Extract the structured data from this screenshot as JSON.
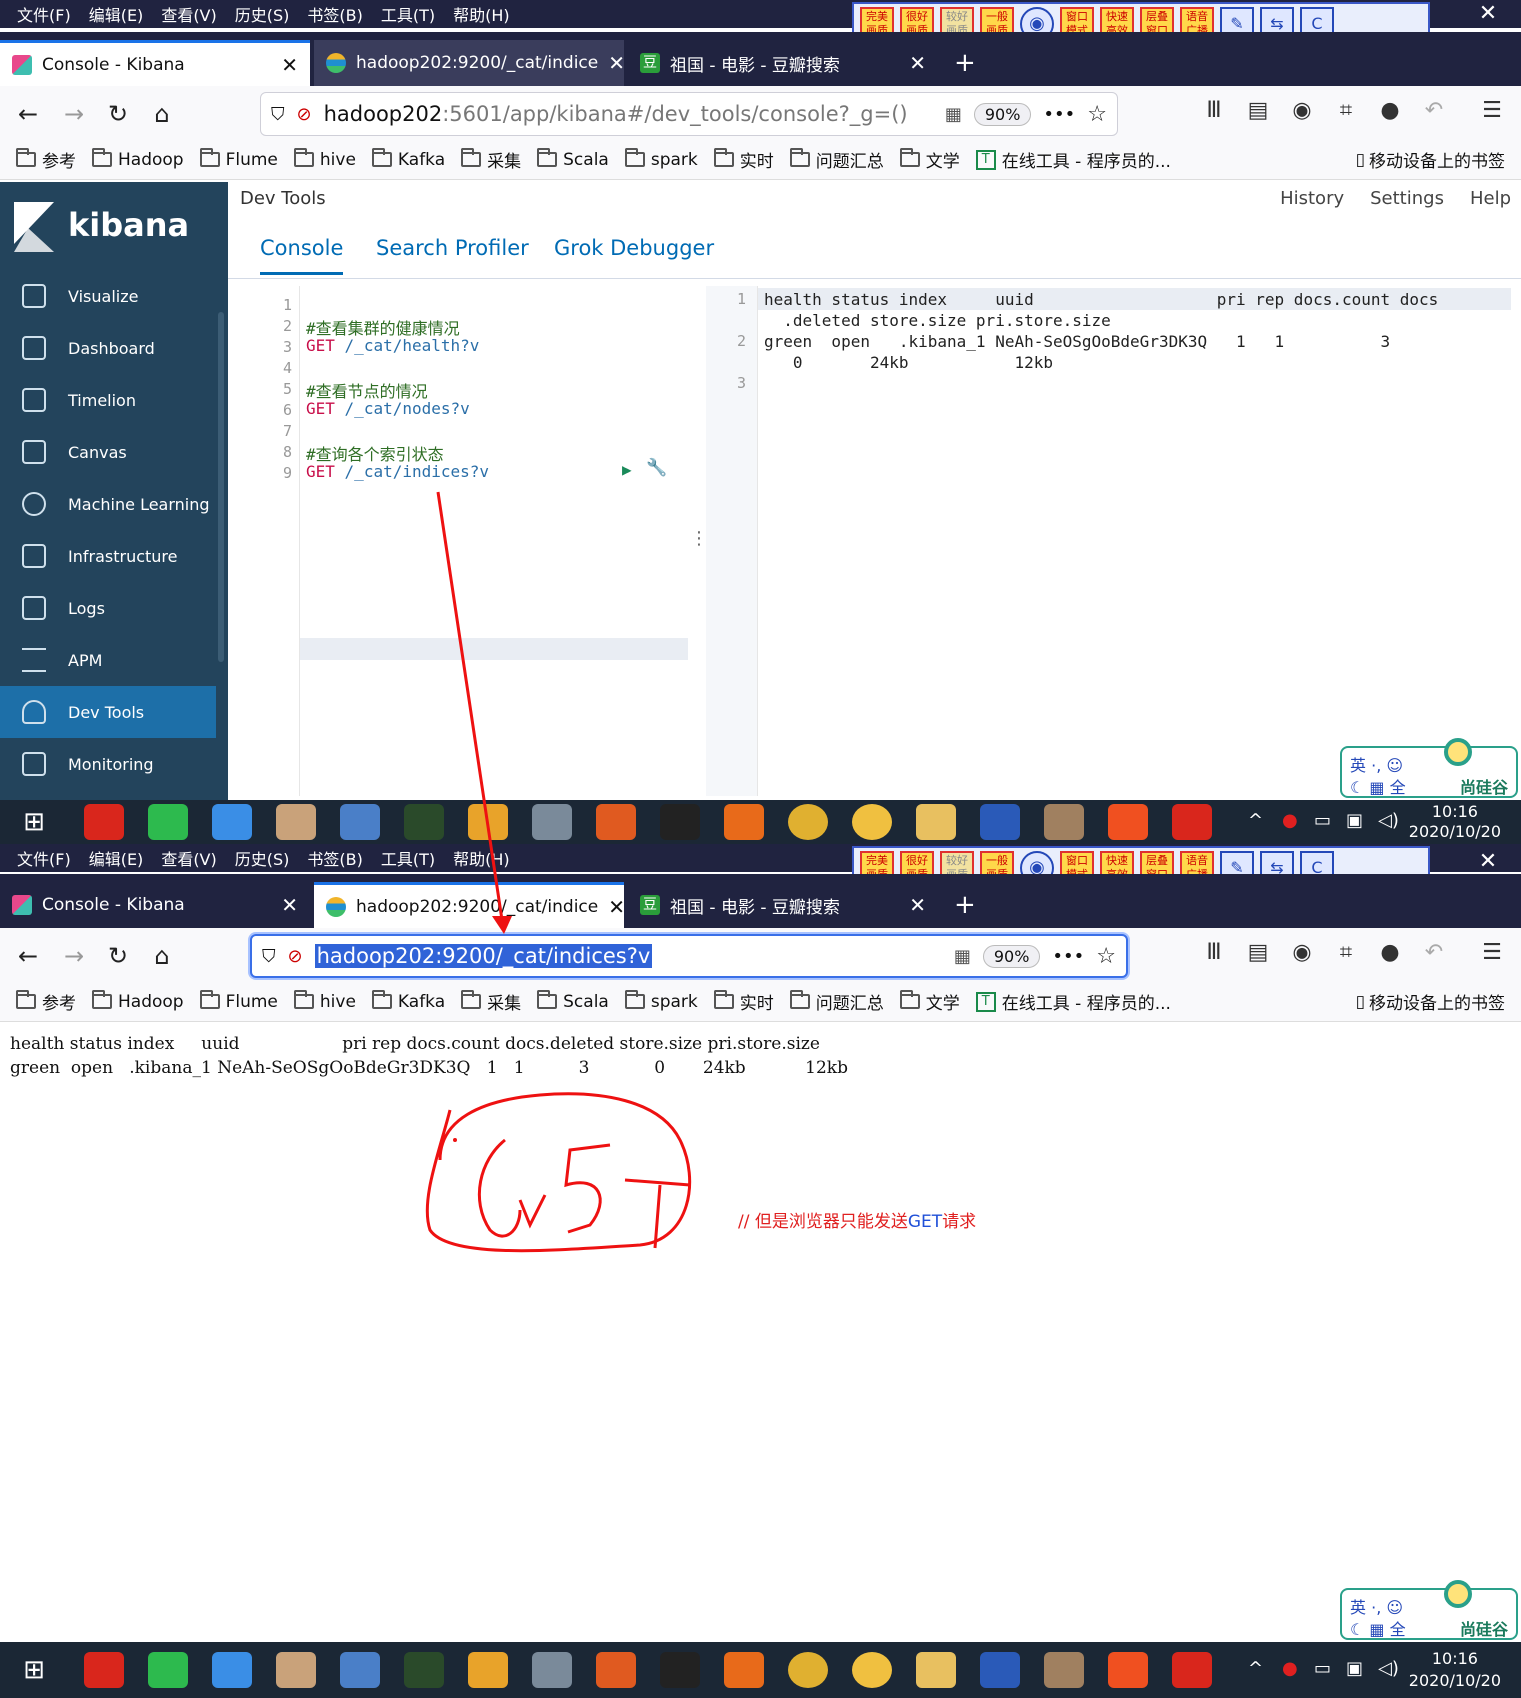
{
  "menu": [
    "文件(F)",
    "编辑(E)",
    "查看(V)",
    "历史(S)",
    "书签(B)",
    "工具(T)",
    "帮助(H)"
  ],
  "toolstrip": {
    "buttons": [
      "完美画质",
      "很好画质",
      "较好画质",
      "一般画质",
      "窗口模式",
      "快速高效",
      "层叠窗口",
      "语音广播"
    ],
    "icons": [
      "gamepad-icon",
      "pen-icon",
      "swap-screen-icon",
      "c-card-icon"
    ]
  },
  "window": {
    "close_glyph": "✕"
  },
  "tabs": [
    {
      "title": "Console - Kibana",
      "close": "✕"
    },
    {
      "title": "hadoop202:9200/_cat/indice",
      "close": "✕"
    },
    {
      "title": "祖国 - 电影 - 豆瓣搜索",
      "close": "✕"
    }
  ],
  "new_tab_glyph": "+",
  "nav_glyphs": {
    "back": "←",
    "forward": "→",
    "reload": "↻",
    "home": "⌂",
    "more": "•••",
    "star": "☆",
    "menu": "☰"
  },
  "top_url": {
    "host": "hadoop202",
    "rest": ":5601/app/kibana#/dev_tools/console?_g=()",
    "zoom": "90%"
  },
  "bottom_url": {
    "text": "hadoop202:9200/_cat/indices?v",
    "zoom": "90%"
  },
  "bookmarks": [
    "参考",
    "Hadoop",
    "Flume",
    "hive",
    "Kafka",
    "采集",
    "Scala",
    "spark",
    "实时",
    "问题汇总",
    "文学"
  ],
  "bookmark_tool": "在线工具 - 程序员的...",
  "bookmark_mobile": "移动设备上的书签",
  "kibana": {
    "brand": "kibana",
    "nav": [
      "Visualize",
      "Dashboard",
      "Timelion",
      "Canvas",
      "Machine Learning",
      "Infrastructure",
      "Logs",
      "APM",
      "Dev Tools",
      "Monitoring"
    ],
    "active_nav": "Dev Tools",
    "page_title": "Dev Tools",
    "header_links": [
      "History",
      "Settings",
      "Help"
    ],
    "tabs": [
      "Console",
      "Search Profiler",
      "Grok Debugger"
    ],
    "editor_lines": [
      {
        "n": "1",
        "comment": "",
        "method": "",
        "path": ""
      },
      {
        "n": "2",
        "comment": "#查看集群的健康情况",
        "method": "",
        "path": ""
      },
      {
        "n": "3",
        "comment": "",
        "method": "GET",
        "path": "/_cat/health?v"
      },
      {
        "n": "4",
        "comment": "",
        "method": "",
        "path": ""
      },
      {
        "n": "5",
        "comment": "#查看节点的情况",
        "method": "",
        "path": ""
      },
      {
        "n": "6",
        "comment": "",
        "method": "GET",
        "path": "/_cat/nodes?v"
      },
      {
        "n": "7",
        "comment": "",
        "method": "",
        "path": ""
      },
      {
        "n": "8",
        "comment": "#查询各个索引状态",
        "method": "",
        "path": ""
      },
      {
        "n": "9",
        "comment": "",
        "method": "GET",
        "path": "/_cat/indices?v"
      }
    ],
    "output_numbers": [
      "1",
      "2",
      "3"
    ],
    "output_lines": [
      "health status index     uuid                   pri rep docs.count docs",
      "  .deleted store.size pri.store.size",
      "green  open   .kibana_1 NeAh-SeOSgOoBdeGr3DK3Q   1   1          3",
      "   0       24kb           12kb"
    ],
    "resizer": "⋮"
  },
  "raw_response": {
    "header": "health status index     uuid                   pri rep docs.count docs.deleted store.size pri.store.size",
    "row": "green  open   .kibana_1 NeAh-SeOSgOoBdeGr3DK3Q   1   1          3            0       24kb           12kb"
  },
  "annotation": {
    "prefix": "// 但是浏览器只能发送",
    "method": "GET",
    "suffix": "请求"
  },
  "ime": {
    "lang": "英",
    "punct": "·,",
    "width": "全",
    "brand": "尚硅谷"
  },
  "taskbar": {
    "apps": [
      "youdao-icon",
      "wechat-icon",
      "baidu-netdisk-icon",
      "avatar-app-icon",
      "search-tool-icon",
      "terminal-icon",
      "eclipse-icon",
      "vm-icon",
      "gallery-icon",
      "tiles-icon",
      "intellij-icon",
      "firefox-icon",
      "chrome-icon",
      "emoji-icon",
      "explorer-icon",
      "word-icon",
      "sublime-icon",
      "sogou-icon"
    ],
    "time": "10:16",
    "date": "2020/10/20",
    "tray_up": "^"
  },
  "colors": {
    "chrome_dark": "#202340",
    "kibana_side": "#23445c",
    "kibana_link": "#006bb4",
    "annotation_red": "#e02020",
    "taskbar": "#1b2735"
  }
}
